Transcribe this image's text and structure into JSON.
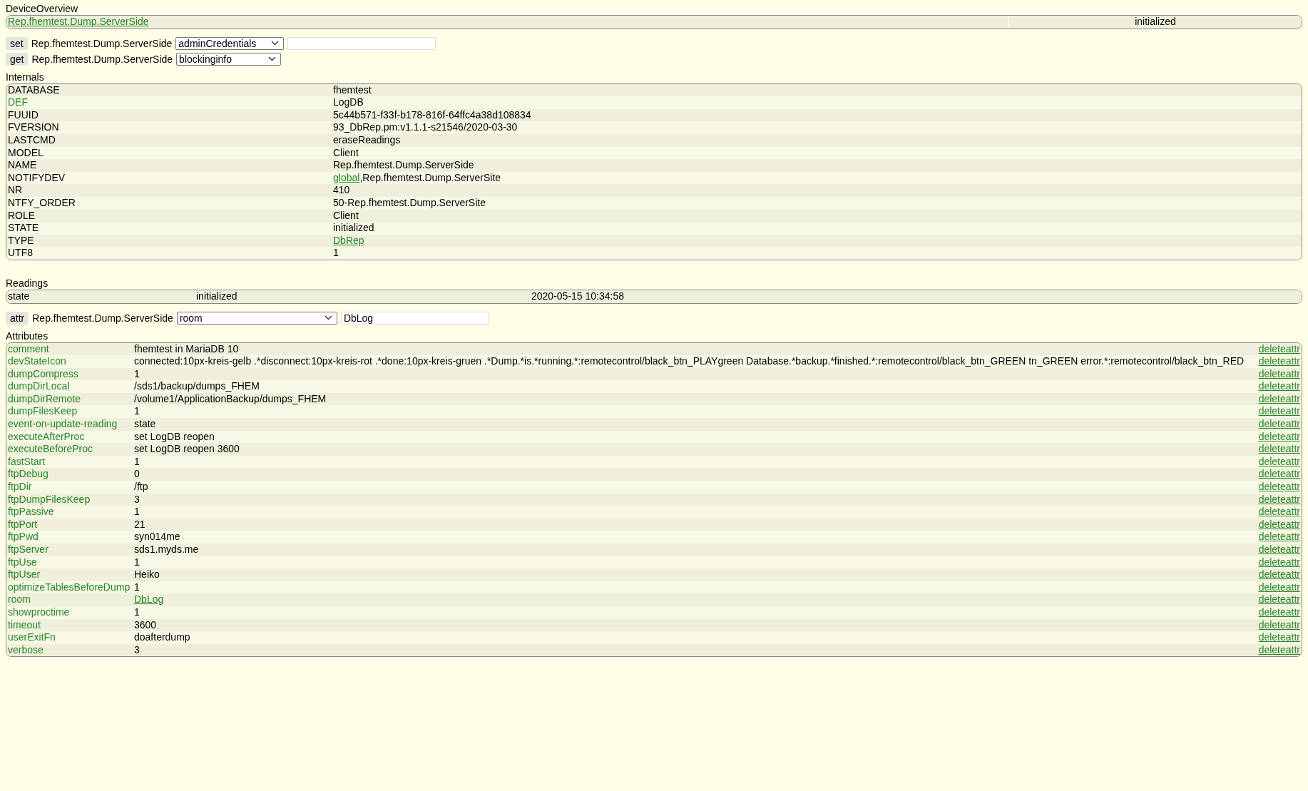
{
  "device_overview": {
    "title": "DeviceOverview",
    "device_link": "Rep.fhemtest.Dump.ServerSide",
    "state": "initialized"
  },
  "commands": [
    {
      "kind": "set",
      "button": "set",
      "device": "Rep.fhemtest.Dump.ServerSide",
      "option": "adminCredentials"
    },
    {
      "kind": "get",
      "button": "get",
      "device": "Rep.fhemtest.Dump.ServerSide",
      "option": "blockinginfo"
    }
  ],
  "internals": {
    "title": "Internals",
    "rows": [
      {
        "name": "DATABASE",
        "name_link": false,
        "value": [
          {
            "text": "fhemtest",
            "link": false
          }
        ]
      },
      {
        "name": "DEF",
        "name_link": true,
        "value": [
          {
            "text": "LogDB",
            "link": false
          }
        ]
      },
      {
        "name": "FUUID",
        "name_link": false,
        "value": [
          {
            "text": "5c44b571-f33f-b178-816f-64ffc4a38d108834",
            "link": false
          }
        ]
      },
      {
        "name": "FVERSION",
        "name_link": false,
        "value": [
          {
            "text": "93_DbRep.pm:v1.1.1-s21546/2020-03-30",
            "link": false
          }
        ]
      },
      {
        "name": "LASTCMD",
        "name_link": false,
        "value": [
          {
            "text": "eraseReadings",
            "link": false
          }
        ]
      },
      {
        "name": "MODEL",
        "name_link": false,
        "value": [
          {
            "text": "Client",
            "link": false
          }
        ]
      },
      {
        "name": "NAME",
        "name_link": false,
        "value": [
          {
            "text": "Rep.fhemtest.Dump.ServerSide",
            "link": false
          }
        ]
      },
      {
        "name": "NOTIFYDEV",
        "name_link": false,
        "value": [
          {
            "text": "global",
            "link": true
          },
          {
            "text": ",Rep.fhemtest.Dump.ServerSite",
            "link": false
          }
        ]
      },
      {
        "name": "NR",
        "name_link": false,
        "value": [
          {
            "text": "410",
            "link": false
          }
        ]
      },
      {
        "name": "NTFY_ORDER",
        "name_link": false,
        "value": [
          {
            "text": "50-Rep.fhemtest.Dump.ServerSite",
            "link": false
          }
        ]
      },
      {
        "name": "ROLE",
        "name_link": false,
        "value": [
          {
            "text": "Client",
            "link": false
          }
        ]
      },
      {
        "name": "STATE",
        "name_link": false,
        "value": [
          {
            "text": "initialized",
            "link": false
          }
        ]
      },
      {
        "name": "TYPE",
        "name_link": false,
        "value": [
          {
            "text": "DbRep",
            "link": true
          }
        ]
      },
      {
        "name": "UTF8",
        "name_link": false,
        "value": [
          {
            "text": "1",
            "link": false
          }
        ]
      }
    ]
  },
  "readings": {
    "title": "Readings",
    "rows": [
      {
        "name": "state",
        "value": "initialized",
        "time": "2020-05-15 10:34:58"
      }
    ]
  },
  "attr_command": {
    "kind": "attr",
    "button": "attr",
    "device": "Rep.fhemtest.Dump.ServerSide",
    "option": "room",
    "value": "DbLog"
  },
  "attributes": {
    "title": "Attributes",
    "rows": [
      {
        "name": "comment",
        "value": "fhemtest in MariaDB 10",
        "link": false,
        "action": "deleteattr"
      },
      {
        "name": "devStateIcon",
        "value": "connected:10px-kreis-gelb .*disconnect:10px-kreis-rot .*done:10px-kreis-gruen .*Dump.*is.*running.*:remotecontrol/black_btn_PLAYgreen Database.*backup.*finished.*:remotecontrol/black_btn_GREEN tn_GREEN error.*:remotecontrol/black_btn_RED",
        "link": false,
        "action": "deleteattr"
      },
      {
        "name": "dumpCompress",
        "value": "1",
        "link": false,
        "action": "deleteattr"
      },
      {
        "name": "dumpDirLocal",
        "value": "/sds1/backup/dumps_FHEM",
        "link": false,
        "action": "deleteattr"
      },
      {
        "name": "dumpDirRemote",
        "value": "/volume1/ApplicationBackup/dumps_FHEM",
        "link": false,
        "action": "deleteattr"
      },
      {
        "name": "dumpFilesKeep",
        "value": "1",
        "link": false,
        "action": "deleteattr"
      },
      {
        "name": "event-on-update-reading",
        "value": "state",
        "link": false,
        "action": "deleteattr"
      },
      {
        "name": "executeAfterProc",
        "value": "set LogDB reopen",
        "link": false,
        "action": "deleteattr"
      },
      {
        "name": "executeBeforeProc",
        "value": "set LogDB reopen 3600",
        "link": false,
        "action": "deleteattr"
      },
      {
        "name": "fastStart",
        "value": "1",
        "link": false,
        "action": "deleteattr"
      },
      {
        "name": "ftpDebug",
        "value": "0",
        "link": false,
        "action": "deleteattr"
      },
      {
        "name": "ftpDir",
        "value": "/ftp",
        "link": false,
        "action": "deleteattr"
      },
      {
        "name": "ftpDumpFilesKeep",
        "value": "3",
        "link": false,
        "action": "deleteattr"
      },
      {
        "name": "ftpPassive",
        "value": "1",
        "link": false,
        "action": "deleteattr"
      },
      {
        "name": "ftpPort",
        "value": "21",
        "link": false,
        "action": "deleteattr"
      },
      {
        "name": "ftpPwd",
        "value": "syn014me",
        "link": false,
        "action": "deleteattr"
      },
      {
        "name": "ftpServer",
        "value": "sds1.myds.me",
        "link": false,
        "action": "deleteattr"
      },
      {
        "name": "ftpUse",
        "value": "1",
        "link": false,
        "action": "deleteattr"
      },
      {
        "name": "ftpUser",
        "value": "Heiko",
        "link": false,
        "action": "deleteattr"
      },
      {
        "name": "optimizeTablesBeforeDump",
        "value": "1",
        "link": false,
        "action": "deleteattr"
      },
      {
        "name": "room",
        "value": "DbLog",
        "link": true,
        "action": "deleteattr"
      },
      {
        "name": "showproctime",
        "value": "1",
        "link": false,
        "action": "deleteattr"
      },
      {
        "name": "timeout",
        "value": "3600",
        "link": false,
        "action": "deleteattr"
      },
      {
        "name": "userExitFn",
        "value": "doafterdump",
        "link": false,
        "action": "deleteattr"
      },
      {
        "name": "verbose",
        "value": "3",
        "link": false,
        "action": "deleteattr"
      }
    ]
  }
}
